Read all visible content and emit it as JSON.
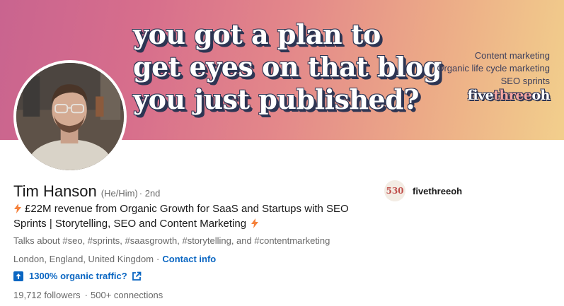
{
  "banner": {
    "headline_lines": [
      "you got a plan to",
      "get eyes on that blog",
      "you just published?"
    ],
    "services": [
      "Content marketing",
      "Organic life cycle marketing",
      "SEO sprints"
    ],
    "logo_parts": [
      "five",
      "three",
      "oh"
    ]
  },
  "profile": {
    "name": "Tim Hanson",
    "pronouns": "(He/Him)",
    "degree": "· 2nd",
    "headline": "£22M revenue from Organic Growth for SaaS and Startups with SEO Sprints | Storytelling, SEO and Content Marketing",
    "talks_about": "Talks about #seo, #sprints, #saasgrowth, #storytelling, and #contentmarketing",
    "location": "London, England, United Kingdom",
    "location_sep": "·",
    "contact_info": "Contact info",
    "website_label": "1300% organic traffic?",
    "followers": "19,712 followers",
    "connections_dot": "·",
    "connections": "500+ connections"
  },
  "company": {
    "logo_text": "530",
    "name": "fivethreeoh"
  },
  "colors": {
    "link": "#0a66c2",
    "bolt": "#f5813b",
    "banner_navy": "#2d3553"
  },
  "icons": {
    "headline_prefix": "lightning-bolt-icon",
    "headline_suffix": "lightning-bolt-icon",
    "website": "arrow-up-box-icon",
    "external": "external-link-icon"
  }
}
